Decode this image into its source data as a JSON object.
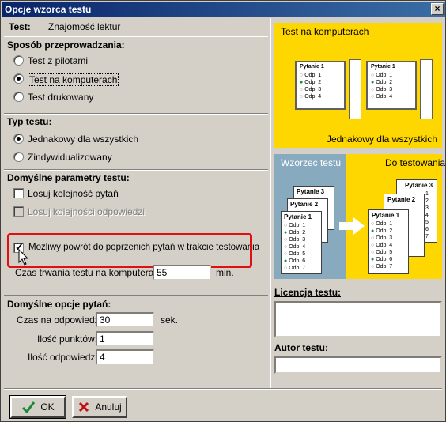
{
  "window": {
    "title": "Opcje wzorca testu",
    "close_symbol": "×"
  },
  "test": {
    "label": "Test:",
    "value": "Znajomość lektur"
  },
  "mode": {
    "label": "Sposób przeprowadzania:",
    "options": [
      {
        "label": "Test z pilotami",
        "selected": false
      },
      {
        "label": "Test na komputerach",
        "selected": true
      },
      {
        "label": "Test drukowany",
        "selected": false
      }
    ]
  },
  "type": {
    "label": "Typ testu:",
    "options": [
      {
        "label": "Jednakowy dla wszystkich",
        "selected": true
      },
      {
        "label": "Zindywidualizowany",
        "selected": false
      }
    ]
  },
  "defaults": {
    "label": "Domyślne parametry testu:",
    "shuffle_questions": {
      "label": "Losuj kolejność pytań",
      "checked": false,
      "enabled": true
    },
    "shuffle_answers": {
      "label": "Losuj kolejności odpowiedzi",
      "checked": false,
      "enabled": false
    },
    "allow_return": {
      "label": "Możliwy powrót do poprzenich pytań w trakcie testowania",
      "checked": true,
      "enabled": true
    },
    "duration": {
      "label": "Czas trwania testu na komputerach:",
      "value": "55",
      "unit": "min."
    }
  },
  "question_defaults": {
    "label": "Domyślne opcje pytań:",
    "answer_time": {
      "label": "Czas na odpowiedź:",
      "value": "30",
      "unit": "sek."
    },
    "points": {
      "label": "Ilość punktów:",
      "value": "1"
    },
    "answers": {
      "label": "Ilość odpowiedzi:",
      "value": "4"
    }
  },
  "illustration_top": {
    "title": "Test na komputerach",
    "caption": "Jednakowy dla wszystkich",
    "question": "Pytanie 1",
    "answers": [
      "Odp. 1",
      "Odp. 2",
      "Odp. 3",
      "Odp. 4"
    ]
  },
  "illustration_bottom": {
    "left_title": "Wzorzec testu",
    "right_title": "Do testowania",
    "cards": [
      "Pytanie 3",
      "Pytanie 2",
      "Pytanie 1"
    ],
    "answers": [
      "Odp. 1",
      "Odp. 2",
      "Odp. 3",
      "Odp. 4",
      "Odp. 5",
      "Odp. 6",
      "Odp. 7"
    ],
    "side_numbers": [
      "1",
      "2",
      "3",
      "4",
      "5",
      "6",
      "7"
    ]
  },
  "license": {
    "label": "Licencja testu:",
    "value": ""
  },
  "author": {
    "label": "Autor testu:",
    "value": ""
  },
  "buttons": {
    "ok": "OK",
    "cancel": "Anuluj"
  },
  "colors": {
    "accent_yellow": "#ffd700",
    "panel_blue": "#88aabf",
    "highlight_red": "#e01010",
    "radio_green": "#1a8a3a"
  }
}
